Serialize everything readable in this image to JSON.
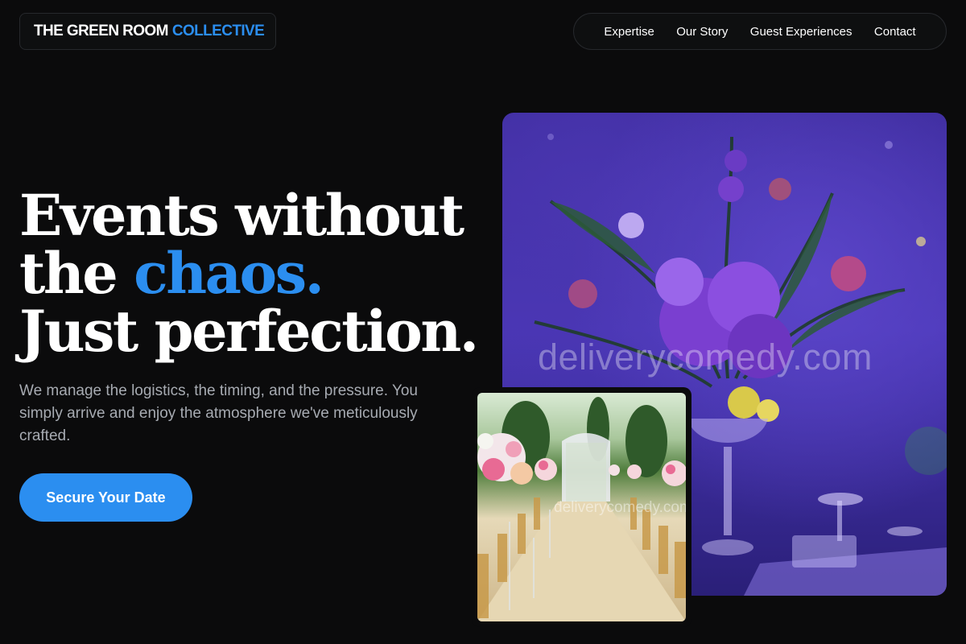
{
  "header": {
    "logo_text": "THE GREEN ROOM",
    "logo_accent": "COLLECTIVE",
    "nav": [
      "Expertise",
      "Our Story",
      "Guest Experiences",
      "Contact"
    ]
  },
  "hero": {
    "headline_line1": "Events without",
    "headline_line2_prefix": "the",
    "headline_line2_accent": "chaos.",
    "headline_line3": "Just perfection.",
    "subtext": "We manage the logistics, the timing, and the pressure. You simply arrive and enjoy the atmosphere we've meticulously crafted.",
    "cta_label": "Secure Your Date"
  },
  "images": {
    "main_watermark": "deliverycomedy.com",
    "secondary_watermark": "deliverycomedy.com"
  },
  "colors": {
    "background": "#0b0b0c",
    "accent": "#2b8ef0",
    "subtext": "#a7abb2"
  }
}
